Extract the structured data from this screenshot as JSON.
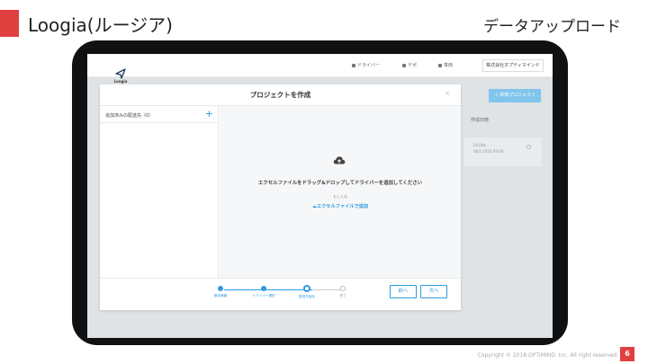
{
  "slide": {
    "title": "Loogia(ルージア)",
    "subtitle": "データアップロード",
    "copyright": "Copyright © 2018 OPTIMIND. Inc. All right reserved.",
    "page_number": "6",
    "accent_color": "#e0403f"
  },
  "app": {
    "brand_name": "Loogia",
    "nav": {
      "drivers": "ドライバー",
      "depots": "デポ",
      "vehicles": "車両",
      "company": "株式会社オプティマインド"
    },
    "background": {
      "new_project_button": "＋ 新規プロジェクト",
      "created_at_label": "作成日時",
      "card_line1": "2018年",
      "card_line2": "08月 2018 09:00"
    },
    "modal": {
      "title": "プロジェクトを作成",
      "close": "×",
      "left_panel_label": "追加済みの配送先（0）",
      "add_symbol": "+",
      "drop_main_text": "エクセルファイルをドラッグ&ドロップしてドライバーを追加してください",
      "drop_or_text": "もしくは",
      "upload_link": "エクセルファイルで追加",
      "steps": [
        {
          "label": "基本情報",
          "state": "done"
        },
        {
          "label": "ドライバー選択",
          "state": "done"
        },
        {
          "label": "配送先追加",
          "state": "current"
        },
        {
          "label": "完了",
          "state": "todo"
        }
      ],
      "prev_button": "前へ",
      "next_button": "次へ"
    },
    "link_color": "#2d9be0"
  }
}
